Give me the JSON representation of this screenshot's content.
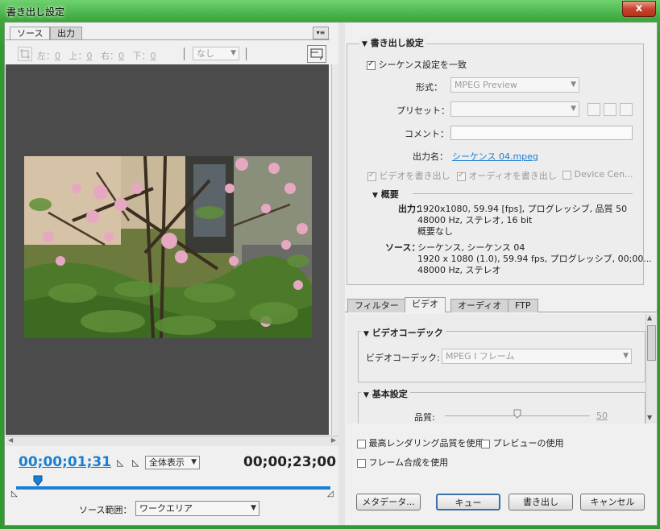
{
  "window": {
    "title": "書き出し設定",
    "close": "x"
  },
  "left": {
    "tabs": [
      "ソース",
      "出力"
    ],
    "panel_menu": "▾≡",
    "crop": {
      "left_label": "左：",
      "left_val": "0",
      "top_label": "上：",
      "top_val": "0",
      "right_label": "右：",
      "right_val": "0",
      "bottom_label": "下：",
      "bottom_val": "0",
      "ratio": "なし"
    },
    "timecode_current": "00;00;01;31",
    "timecode_duration": "00;00;23;00",
    "zoom": "全体表示",
    "source_range_label": "ソース範囲：",
    "source_range_value": "ワークエリア"
  },
  "export": {
    "section_title": "書き出し設定",
    "match_sequence": "シーケンス設定を一致",
    "format_label": "形式：",
    "format_value": "MPEG Preview",
    "preset_label": "プリセット：",
    "preset_value": "",
    "comment_label": "コメント：",
    "comment_value": "",
    "output_name_label": "出力名：",
    "output_name": "シーケンス 04.mpeg",
    "export_video": "ビデオを書き出し",
    "export_audio": "オーディオを書き出し",
    "device_central": "Device Cen..."
  },
  "summary": {
    "title": "概要",
    "output_label": "出力：",
    "output_lines": [
      "1920x1080, 59.94 [fps], プログレッシブ, 品質 50",
      "48000 Hz, ステレオ, 16 bit",
      "概要なし"
    ],
    "source_label": "ソース：",
    "source_lines": [
      "シーケンス, シーケンス 04",
      "1920 x 1080 (1.0), 59.94 fps, プログレッシブ, 00;00...",
      "48000 Hz, ステレオ"
    ]
  },
  "tabs": [
    "フィルター",
    "ビデオ",
    "オーディオ",
    "FTP"
  ],
  "video": {
    "codec_section": "ビデオコーデック",
    "codec_label": "ビデオコーデック:",
    "codec_value": "MPEG I フレーム",
    "basic_section": "基本設定",
    "quality_label": "品質:",
    "quality_value": "50"
  },
  "options": {
    "max_render": "最高レンダリング品質を使用",
    "use_preview": "プレビューの使用",
    "frame_blend": "フレーム合成を使用"
  },
  "buttons": {
    "metadata": "メタデータ...",
    "queue": "キュー",
    "export": "書き出し",
    "cancel": "キャンセル"
  },
  "colors": {
    "accent": "#1a7fd4",
    "title_green": "#3ea83e"
  }
}
